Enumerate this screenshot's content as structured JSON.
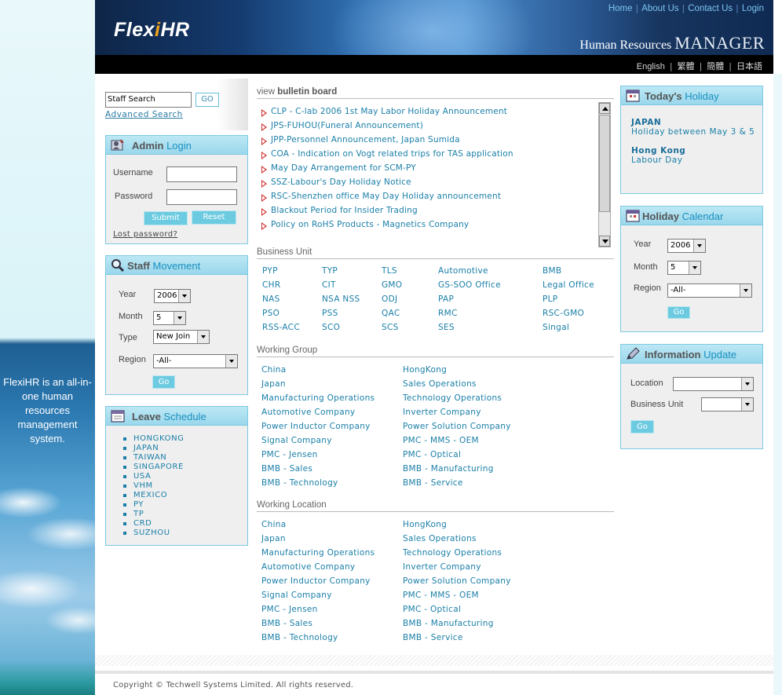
{
  "brand": {
    "logo_prefix": "Flex",
    "logo_i": "i",
    "logo_suffix": "HR",
    "product_word": "Human Resources",
    "product_manager": "MANAGER",
    "tagline": "FlexiHR is an all-in-one human resources management system."
  },
  "topnav": [
    "Home",
    "About Us",
    "Contact Us",
    "Login"
  ],
  "languages": [
    "English",
    "繁體",
    "簡體",
    "日本語"
  ],
  "search": {
    "value": "Staff Search",
    "go_label": "GO",
    "advanced_label": "Advanced Search"
  },
  "admin_login": {
    "title_bold": "Admin",
    "title_light": "Login",
    "username_label": "Username",
    "password_label": "Password",
    "submit_label": "Submit",
    "reset_label": "Reset",
    "lost_password": "Lost password?"
  },
  "staff_movement": {
    "title_bold": "Staff",
    "title_light": "Movement",
    "year_label": "Year",
    "year_value": "2006",
    "month_label": "Month",
    "month_value": "5",
    "type_label": "Type",
    "type_value": "New Join",
    "region_label": "Region",
    "region_value": "-All-",
    "go_label": "Go"
  },
  "leave_schedule": {
    "title_bold": "Leave",
    "title_light": "Schedule",
    "items": [
      "HONGKONG",
      "JAPAN",
      "TAIWAN",
      "SINGAPORE",
      "USA",
      "VHM",
      "MEXICO",
      "PY",
      "TP",
      "CRD",
      "SUZHOU"
    ]
  },
  "bulletin": {
    "title_light": "view",
    "title_bold": "bulletin board",
    "items": [
      "CLP - C-lab 2006 1st May Labor Holiday Announcement",
      "JPS-FUHOU(Funeral Announcement)",
      "JPP-Personnel Announcement, Japan Sumida",
      "COA - Indication on Vogt related trips for TAS application",
      "May Day Arrangement for SCM-PY",
      "SSZ-Labour's Day Holiday Notice",
      "RSC-Shenzhen office May Day Holiday announcement",
      "Blackout Period for Insider Trading",
      "Policy on RoHS Products - Magnetics Company"
    ]
  },
  "business_unit": {
    "title": "Business Unit",
    "columns": [
      [
        "PYP",
        "CHR",
        "NAS",
        "PSO",
        "RSS-ACC"
      ],
      [
        "TYP",
        "CIT",
        "NSA NSS",
        "PSS",
        "SCO"
      ],
      [
        "TLS",
        "GMO",
        "ODJ",
        "QAC",
        "SCS"
      ],
      [
        "Automotive",
        "GS-SOO Office",
        "PAP",
        "RMC",
        "SES"
      ],
      [
        "BMB",
        "Legal Office",
        "PLP",
        "RSC-GMO",
        "Singal"
      ]
    ]
  },
  "working_group": {
    "title": "Working Group",
    "columns": [
      [
        "China",
        "Japan",
        "Manufacturing Operations",
        "Automotive Company",
        "Power Inductor Company",
        "Signal Company",
        "PMC - Jensen",
        "BMB - Sales",
        "BMB - Technology"
      ],
      [
        "HongKong",
        "Sales Operations",
        "Technology Operations",
        "Inverter Company",
        "Power Solution Company",
        "PMC - MMS - OEM",
        "PMC - Optical",
        "BMB - Manufacturing",
        "BMB - Service"
      ]
    ]
  },
  "working_location": {
    "title": "Working Location",
    "columns": [
      [
        "China",
        "Japan",
        "Manufacturing Operations",
        "Automotive Company",
        "Power Inductor Company",
        "Signal Company",
        "PMC - Jensen",
        "BMB - Sales",
        "BMB - Technology"
      ],
      [
        "HongKong",
        "Sales Operations",
        "Technology Operations",
        "Inverter Company",
        "Power Solution Company",
        "PMC - MMS - OEM",
        "PMC - Optical",
        "BMB - Manufacturing",
        "BMB - Service"
      ]
    ]
  },
  "todays_holiday": {
    "title_bold": "Today's",
    "title_light": "Holiday",
    "entries": [
      {
        "place": "JAPAN",
        "desc": "Holiday between May 3 & 5"
      },
      {
        "place": "Hong Kong",
        "desc": "Labour Day"
      }
    ]
  },
  "holiday_calendar": {
    "title_bold": "Holiday",
    "title_light": "Calendar",
    "year_label": "Year",
    "year_value": "2006",
    "month_label": "Month",
    "month_value": "5",
    "region_label": "Region",
    "region_value": "-All-",
    "go_label": "Go"
  },
  "info_update": {
    "title_bold": "Information",
    "title_light": "Update",
    "location_label": "Location",
    "location_value": "",
    "bu_label": "Business Unit",
    "bu_value": "",
    "go_label": "Go"
  },
  "footer": {
    "copyright": "Copyright © Techwell Systems Limited. All rights reserved."
  },
  "colors": {
    "accent": "#1a7fa8",
    "panel_header": "#9ad7ec",
    "bullet_red": "#d12b2b",
    "topbar_black": "#000000"
  }
}
